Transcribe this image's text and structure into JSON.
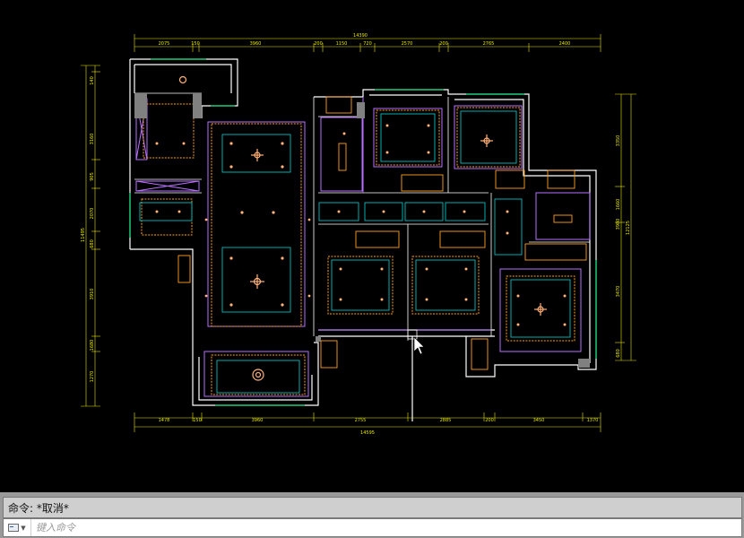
{
  "command_line": {
    "history": "命令: *取消*",
    "placeholder": "键入命令"
  },
  "drawing": {
    "dims_top": [
      "2075",
      "150",
      "3960",
      "200",
      "1150",
      "720",
      "2570",
      "200",
      "2765",
      "2400"
    ],
    "dim_top_total": "14390",
    "dims_bottom": [
      "1478",
      "150",
      "3960",
      "2755",
      "2885",
      "200",
      "3450",
      "1370"
    ],
    "dim_bottom_total": "14595",
    "dims_left": [
      "140",
      "3160",
      "905",
      "2070",
      "680",
      "3910",
      "1680",
      "1270"
    ],
    "dim_left_total": "11495",
    "dims_right": [
      "3350",
      "1660",
      "3980",
      "3470",
      "680"
    ],
    "dim_right_total": "12125",
    "colors": {
      "wall": "#ffffff",
      "dim": "#e6e600",
      "ceiling": "#ffa020",
      "cabinet": "#b870ff",
      "trim": "#00c0c0",
      "light": "#ffb27a",
      "background": "#000000"
    }
  }
}
